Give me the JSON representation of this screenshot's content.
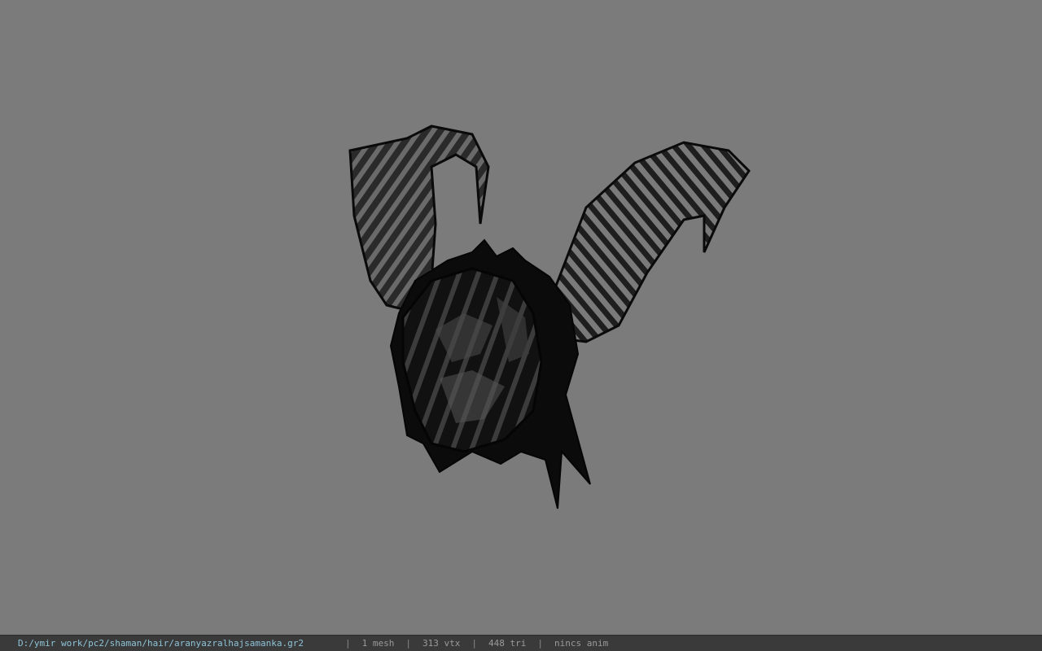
{
  "viewport": {
    "background": "#7b7b7b",
    "model_icon": "horned-hair-mesh"
  },
  "status": {
    "file_path": "D:/ymir work/pc2/shaman/hair/aranyazralhajsamanka.gr2",
    "separator": "|",
    "mesh": "1 mesh",
    "vtx": "313 vtx",
    "tri": "448 tri",
    "anim": "nincs anim"
  }
}
